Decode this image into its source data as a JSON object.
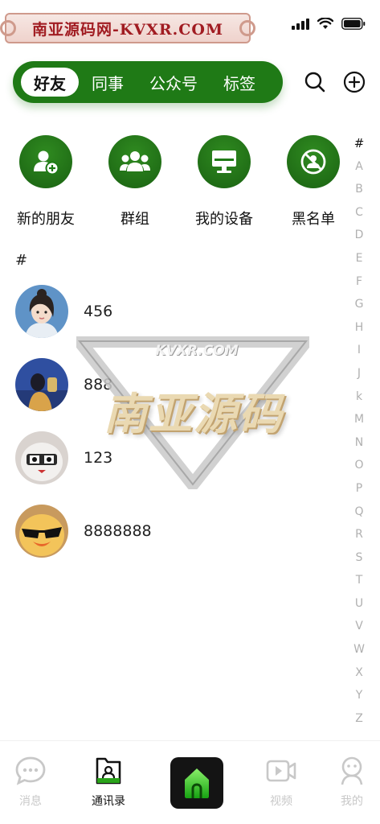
{
  "status": {
    "banner_text": "南亚源码网-KVXR.COM",
    "icons": [
      "signal-icon",
      "wifi-icon",
      "battery-icon"
    ]
  },
  "header": {
    "tabs": [
      {
        "label": "好友",
        "active": true
      },
      {
        "label": "同事",
        "active": false
      },
      {
        "label": "公众号",
        "active": false
      },
      {
        "label": "标签",
        "active": false
      }
    ],
    "actions": [
      "search-icon",
      "add-circle-icon"
    ],
    "accent_color": "#1f7a16"
  },
  "shortcuts": [
    {
      "label": "新的朋友",
      "icon": "add-friend-icon"
    },
    {
      "label": "群组",
      "icon": "group-icon"
    },
    {
      "label": "我的设备",
      "icon": "device-icon"
    },
    {
      "label": "黑名单",
      "icon": "blacklist-icon"
    }
  ],
  "section": {
    "header": "#"
  },
  "contacts": [
    {
      "name": "456",
      "avatar": "avatar-girl"
    },
    {
      "name": "888",
      "avatar": "avatar-photo"
    },
    {
      "name": "123",
      "avatar": "avatar-robot"
    },
    {
      "name": "8888888",
      "avatar": "avatar-duck"
    }
  ],
  "index_letters": [
    "#",
    "A",
    "B",
    "C",
    "D",
    "E",
    "F",
    "G",
    "H",
    "I",
    "J",
    "k",
    "M",
    "N",
    "O",
    "P",
    "Q",
    "R",
    "S",
    "T",
    "U",
    "V",
    "W",
    "X",
    "Y",
    "Z"
  ],
  "watermark": {
    "url": "KVXR.COM",
    "title": "南亚源码"
  },
  "bottom_nav": [
    {
      "label": "消息",
      "icon": "message-icon",
      "active": false
    },
    {
      "label": "通讯录",
      "icon": "contacts-icon",
      "active": true
    },
    {
      "label": "",
      "icon": "home-icon",
      "active": false
    },
    {
      "label": "视频",
      "icon": "video-icon",
      "active": false
    },
    {
      "label": "我的",
      "icon": "profile-icon",
      "active": false
    }
  ]
}
